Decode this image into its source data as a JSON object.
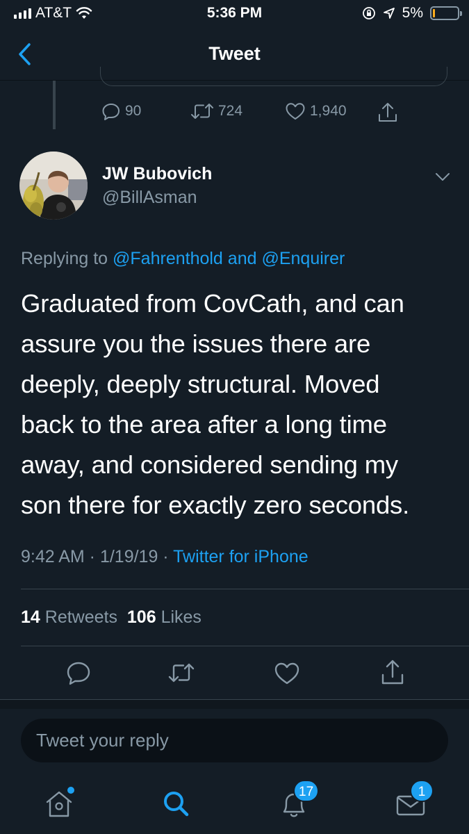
{
  "status_bar": {
    "carrier": "AT&T",
    "time": "5:36 PM",
    "battery_percent": "5%",
    "battery_level": 0.05,
    "battery_color": "#ffad1f"
  },
  "nav": {
    "title": "Tweet"
  },
  "parent_tweet": {
    "replies": "90",
    "retweets": "724",
    "likes": "1,940"
  },
  "reply_tweet": {
    "display_name": "JW Bubovich",
    "handle": "@BillAsman",
    "replying_prefix": "Replying to",
    "replying_to_1": "@Fahrenthold",
    "replying_and": "and",
    "replying_to_2": "@Enquirer",
    "text": "Graduated from CovCath, and can\nassure you the issues there are\ndeeply, deeply structural.   Moved\nback to the area after a long time\naway, and considered sending my\nson there for exactly zero seconds.",
    "time": "9:42 AM · 1/19/19 ·",
    "source": "Twitter for iPhone",
    "retweet_count": "14",
    "retweet_label": "Retweets",
    "like_count": "106",
    "like_label": "Likes"
  },
  "reply_composer": {
    "placeholder": "Tweet your reply"
  },
  "tab_bar": {
    "notifications_badge": "17",
    "messages_badge": "1"
  },
  "colors": {
    "background": "#141d26",
    "accent": "#1da1f2",
    "secondary_text": "#8899a6",
    "divider": "#38444d"
  },
  "icons": [
    "wifi-icon",
    "lock-rotation-icon",
    "location-arrow-icon",
    "back-chevron-icon",
    "reply-icon",
    "retweet-icon",
    "like-icon",
    "share-icon",
    "chevron-down-icon",
    "home-icon",
    "search-icon",
    "notifications-bell-icon",
    "messages-envelope-icon"
  ]
}
